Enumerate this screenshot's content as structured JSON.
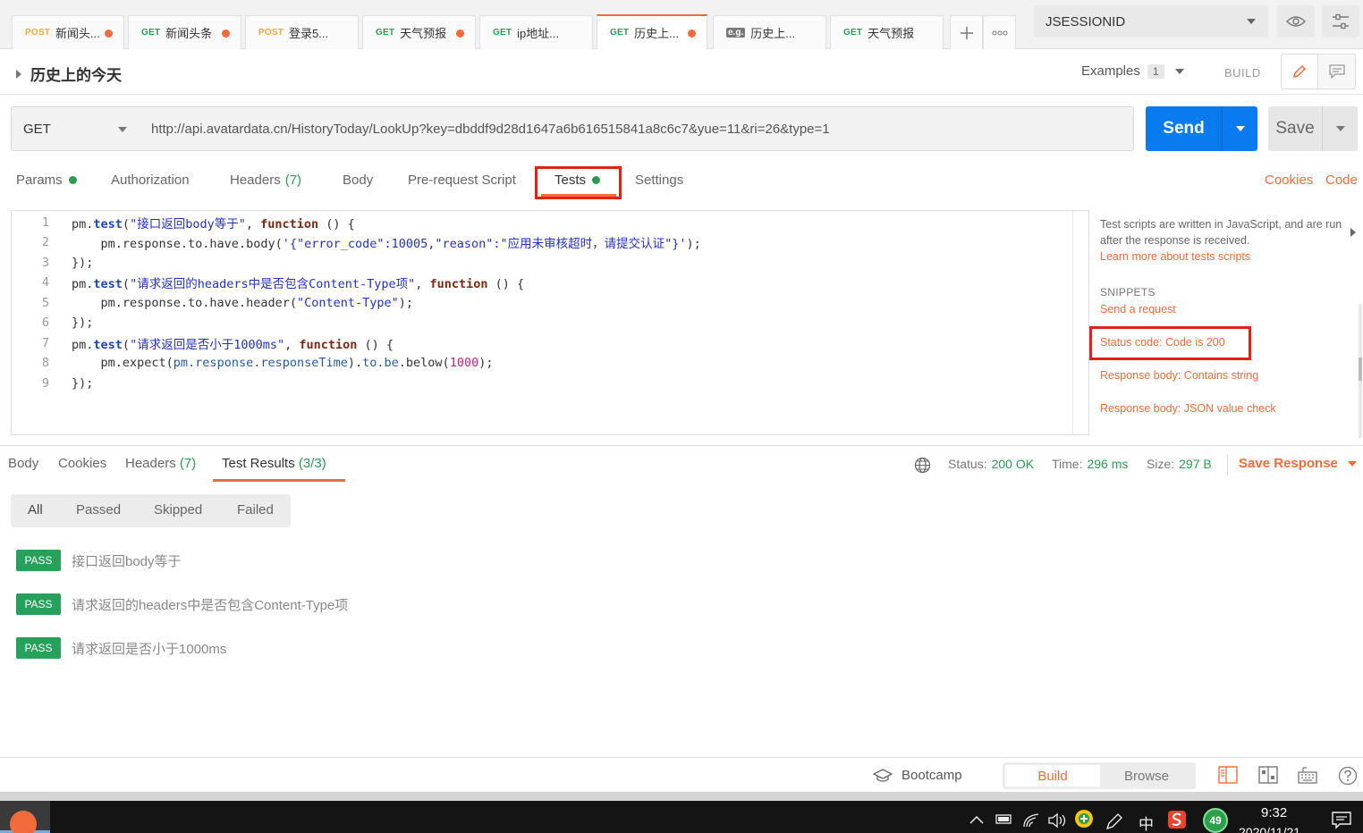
{
  "tabs": [
    {
      "method": "POST",
      "label": "新闻头...",
      "unsaved": true
    },
    {
      "method": "GET",
      "label": "新闻头条",
      "unsaved": true
    },
    {
      "method": "POST",
      "label": "登录5...",
      "unsaved": false
    },
    {
      "method": "GET",
      "label": "天气预报",
      "unsaved": true
    },
    {
      "method": "GET",
      "label": "ip地址...",
      "unsaved": false
    },
    {
      "method": "GET",
      "label": "历史上...",
      "unsaved": true,
      "active": true
    },
    {
      "method": "e.g.",
      "label": "历史上...",
      "unsaved": false
    },
    {
      "method": "GET",
      "label": "天气预报",
      "unsaved": false
    }
  ],
  "environment": {
    "selected": "JSESSIONID"
  },
  "request": {
    "title": "历史上的今天",
    "examples_label": "Examples",
    "examples_count": "1",
    "build_label": "BUILD",
    "method": "GET",
    "url": "http://api.avatardata.cn/HistoryToday/LookUp?key=dbddf9d28d1647a6b616515841a8c6c7&yue=11&ri=26&type=1",
    "send_label": "Send",
    "save_label": "Save"
  },
  "request_tabs": {
    "params": "Params",
    "authorization": "Authorization",
    "headers": "Headers",
    "headers_count": "(7)",
    "body": "Body",
    "prerequest": "Pre-request Script",
    "tests": "Tests",
    "settings": "Settings",
    "cookies": "Cookies",
    "code": "Code"
  },
  "editor": {
    "line_numbers": [
      "1",
      "2",
      "3",
      "4",
      "5",
      "6",
      "7",
      "8",
      "9"
    ]
  },
  "snippets": {
    "description": "Test scripts are written in JavaScript, and are run after the response is received.",
    "learn_more": "Learn more about tests scripts",
    "heading": "SNIPPETS",
    "items": [
      "Send a request",
      "Status code: Code is 200",
      "Response body: Contains string",
      "Response body: JSON value check"
    ]
  },
  "response": {
    "tabs": {
      "body": "Body",
      "cookies": "Cookies",
      "headers": "Headers",
      "headers_count": "(7)",
      "results": "Test Results",
      "results_count": "(3/3)"
    },
    "status_label": "Status:",
    "status_value": "200 OK",
    "time_label": "Time:",
    "time_value": "296 ms",
    "size_label": "Size:",
    "size_value": "297 B",
    "save_response": "Save Response",
    "filters": [
      "All",
      "Passed",
      "Skipped",
      "Failed"
    ],
    "results": [
      {
        "badge": "PASS",
        "name": "接口返回body等于"
      },
      {
        "badge": "PASS",
        "name": "请求返回的headers中是否包含Content-Type项"
      },
      {
        "badge": "PASS",
        "name": "请求返回是否小于1000ms"
      }
    ]
  },
  "statusbar": {
    "bootcamp": "Bootcamp",
    "build": "Build",
    "browse": "Browse"
  },
  "taskbar": {
    "ime": "中",
    "badge": "49",
    "time": "9:32",
    "date": "2020/11/21"
  },
  "colors": {
    "accent": "#f26b3a",
    "send_blue": "#097bed",
    "pass_green": "#26a05b",
    "highlight_red": "#e2211c"
  }
}
